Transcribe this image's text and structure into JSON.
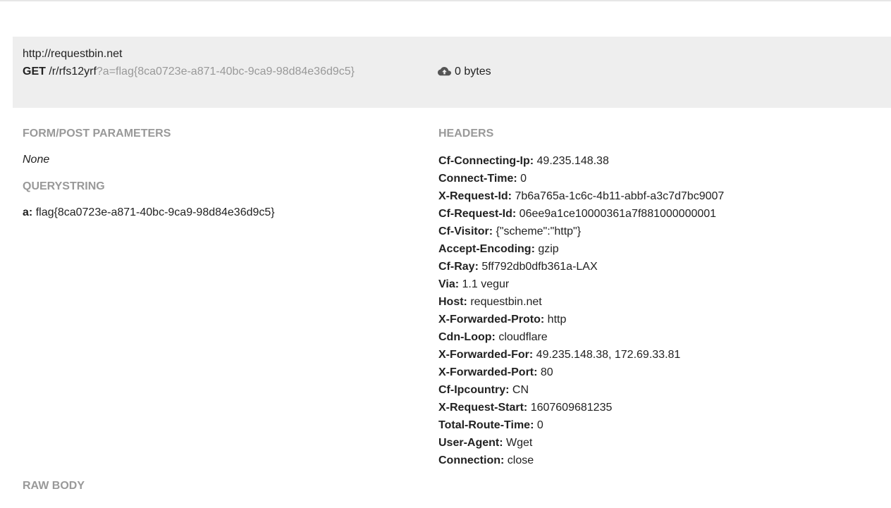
{
  "request": {
    "host_url": "http://requestbin.net",
    "method": "GET",
    "path": "/r/rfs12yrf",
    "query": "?a=flag{8ca0723e-a871-40bc-9ca9-98d84e36d9c5}",
    "size": "0 bytes",
    "size_icon": "cloud-upload-icon"
  },
  "form": {
    "title": "FORM/POST PARAMETERS",
    "empty": "None"
  },
  "querystring": {
    "title": "QUERYSTRING",
    "params": [
      {
        "key": "a:",
        "value": "flag{8ca0723e-a871-40bc-9ca9-98d84e36d9c5}"
      }
    ]
  },
  "headers": {
    "title": "HEADERS",
    "items": [
      {
        "key": "Cf-Connecting-Ip:",
        "value": "49.235.148.38"
      },
      {
        "key": "Connect-Time:",
        "value": "0"
      },
      {
        "key": "X-Request-Id:",
        "value": "7b6a765a-1c6c-4b11-abbf-a3c7d7bc9007"
      },
      {
        "key": "Cf-Request-Id:",
        "value": "06ee9a1ce10000361a7f881000000001"
      },
      {
        "key": "Cf-Visitor:",
        "value": "{\"scheme\":\"http\"}"
      },
      {
        "key": "Accept-Encoding:",
        "value": "gzip"
      },
      {
        "key": "Cf-Ray:",
        "value": "5ff792db0dfb361a-LAX"
      },
      {
        "key": "Via:",
        "value": "1.1 vegur"
      },
      {
        "key": "Host:",
        "value": "requestbin.net"
      },
      {
        "key": "X-Forwarded-Proto:",
        "value": "http"
      },
      {
        "key": "Cdn-Loop:",
        "value": "cloudflare"
      },
      {
        "key": "X-Forwarded-For:",
        "value": "49.235.148.38, 172.69.33.81"
      },
      {
        "key": "X-Forwarded-Port:",
        "value": "80"
      },
      {
        "key": "Cf-Ipcountry:",
        "value": "CN"
      },
      {
        "key": "X-Request-Start:",
        "value": "1607609681235"
      },
      {
        "key": "Total-Route-Time:",
        "value": "0"
      },
      {
        "key": "User-Agent:",
        "value": "Wget"
      },
      {
        "key": "Connection:",
        "value": "close"
      }
    ]
  },
  "raw_body": {
    "title": "RAW BODY"
  },
  "colors": {
    "panel_bg": "#eeeeee",
    "section_title": "#999999",
    "query_muted": "#999999",
    "text": "#222222"
  }
}
